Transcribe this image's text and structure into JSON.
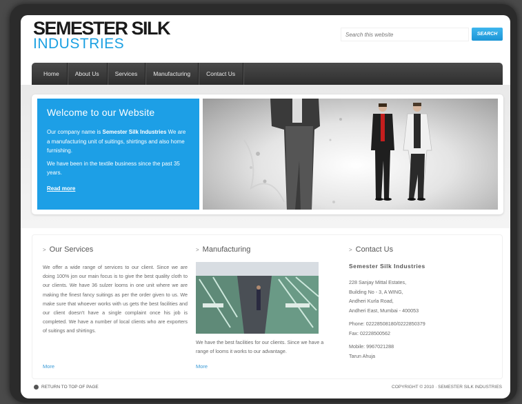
{
  "header": {
    "logo_line1": "SEMESTER SILK",
    "logo_line2": "INDUSTRIES",
    "search_placeholder": "Search this website",
    "search_button": "SEARCH"
  },
  "nav": [
    "Home",
    "About Us",
    "Services",
    "Manufacturing",
    "Contact Us"
  ],
  "welcome": {
    "title": "Welcome to our Website",
    "p1_prefix": "Our company name is ",
    "p1_bold": "Semester Silk Industries",
    "p1_rest": " We are a manufacturing unit of suitings, shirtings and also home furnishing.",
    "p2": "We have been in the textile business since the past 35 years.",
    "read_more": "Read more"
  },
  "services": {
    "title": "Our Services",
    "body": "We offer a wide range of services to our client. Since we are doing 100% jon our main focus is to give the best quality cloth to our clients. We have 36 sulzer looms in one unit where we are making the finest fancy suitings as per the order given to us. We make sure that whoever works with us gets the best facilities and our client doesn't have a single complaint once his job is completed. We have a number of local clients who are exporters of suitings and shirtings.",
    "more": "More"
  },
  "manufacturing": {
    "title": "Manufacturing",
    "body": "We have the best facilities for our clients. Since we have a range of looms it works to our advantage.",
    "more": "More"
  },
  "contact": {
    "title": "Contact Us",
    "company": "Semester Silk Industries",
    "address": [
      "228 Sanjay Mittal Estates,",
      "Building No - 3, A WING,",
      "Andheri Kurla Road,",
      "Andheri East, Mumbai - 400053"
    ],
    "phone": "Phone: 02228508180/0222850379",
    "fax": "Fax: 02228500562",
    "mobile": "Mobile: 9967021288",
    "person": "Tarun Ahuja"
  },
  "footer": {
    "back_to_top": "RETURN TO TOP OF PAGE",
    "copyright": "COPYRIGHT © 2010 · SEMESTER SILK INDUSTRIES"
  },
  "colors": {
    "accent": "#1d9fe6",
    "nav_bg": "#333333",
    "logo_blue": "#1ba0e2"
  }
}
